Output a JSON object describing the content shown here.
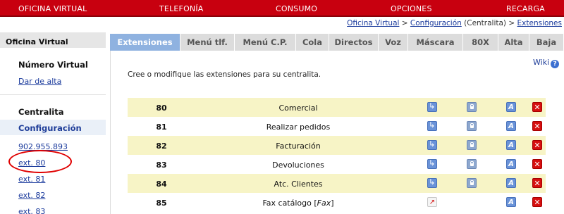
{
  "nav": {
    "items": [
      "OFICINA VIRTUAL",
      "TELEFONÍA",
      "CONSUMO",
      "OPCIONES",
      "RECARGA"
    ]
  },
  "breadcrumb": {
    "oficina": "Oficina Virtual",
    "sep1": " > ",
    "configuracion": "Configuración",
    "context": " (Centralita) > ",
    "extensiones": "Extensiones"
  },
  "sidebar": {
    "title": "Oficina Virtual",
    "numero_virtual": "Número Virtual",
    "dar_de_alta": "Dar de alta",
    "centralita": "Centralita",
    "configuracion": "Configuración",
    "links": [
      "902.955.893",
      "ext. 80",
      "ext. 81",
      "ext. 82",
      "ext. 83"
    ]
  },
  "tabs": [
    "Extensiones",
    "Menú tlf.",
    "Menú C.P.",
    "Cola",
    "Directos",
    "Voz",
    "Máscara",
    "80X",
    "Alta",
    "Baja"
  ],
  "active_tab": "Extensiones",
  "content": {
    "wiki": "Wiki",
    "wiki_icon": "?",
    "intro": "Cree o modifique las extensiones para su centralita.",
    "rows": [
      {
        "ext": "80",
        "name": "Comercial",
        "first_icon": "transfer"
      },
      {
        "ext": "81",
        "name": "Realizar pedidos",
        "first_icon": "transfer"
      },
      {
        "ext": "82",
        "name": "Facturación",
        "first_icon": "transfer"
      },
      {
        "ext": "83",
        "name": "Devoluciones",
        "first_icon": "transfer"
      },
      {
        "ext": "84",
        "name": "Atc. Clientes",
        "first_icon": "transfer"
      },
      {
        "ext": "85",
        "name": "Fax catálogo [Fax]",
        "first_icon": "pdf"
      }
    ]
  },
  "colors": {
    "nav_bg": "#c8000f",
    "active_tab_bg": "#8fb2e0",
    "row_highlight": "#f7f4c6",
    "link": "#1a3a9c",
    "annotation": "#e00000"
  }
}
